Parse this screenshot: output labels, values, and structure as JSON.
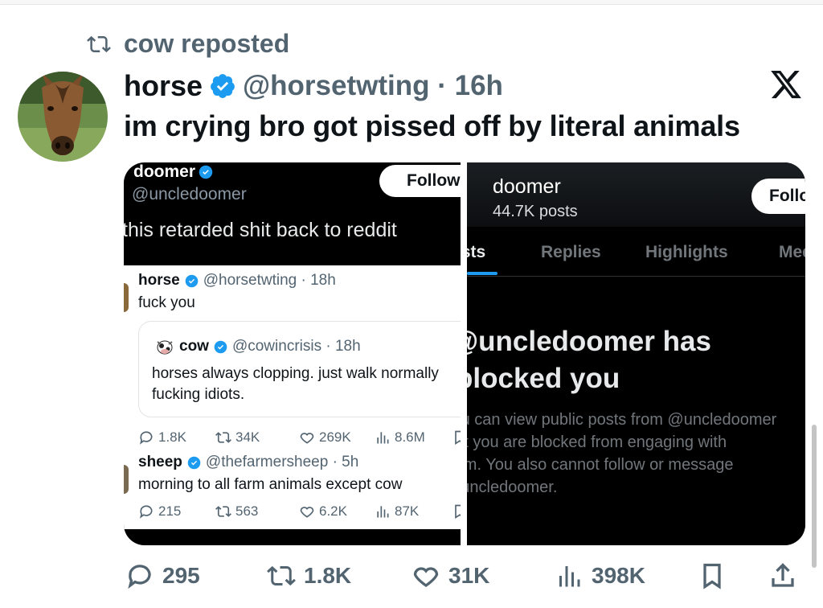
{
  "repost": {
    "label": "cow reposted"
  },
  "tweet": {
    "author_name": "horse",
    "handle_time": "@horsetwting · 16h",
    "text": "im crying bro got pissed off by literal animals"
  },
  "left_shot": {
    "top_name": "doomer",
    "top_handle": "@uncledoomer",
    "follow_label": "Follow",
    "top_text": "this retarded shit back to reddit",
    "reply1": {
      "name": "horse",
      "handle_time": "@horsetwting · 18h",
      "text": "fuck you"
    },
    "quote": {
      "name": "cow",
      "handle_time": "@cowincrisis · 18h",
      "line1": "horses always clopping. just walk normally",
      "line2": "fucking idiots."
    },
    "actions1": {
      "replies": "1.8K",
      "reposts": "34K",
      "likes": "269K",
      "views": "8.6M"
    },
    "reply2": {
      "name": "sheep",
      "handle_time": "@thefarmersheep · 5h",
      "text": "morning to all farm animals except cow"
    },
    "actions2": {
      "replies": "215",
      "reposts": "563",
      "likes": "6.2K",
      "views": "87K"
    }
  },
  "right_shot": {
    "name": "doomer",
    "posts": "44.7K posts",
    "follow_label": "Follow",
    "tabs": [
      "Posts",
      "Replies",
      "Highlights",
      "Media"
    ],
    "blocked_line1": "@uncledoomer has",
    "blocked_line2": "blocked you",
    "desc_line1": "You can view public posts from @uncledoomer",
    "desc_line2": "but you are blocked from engaging with",
    "desc_line3": "them. You also cannot follow or message",
    "desc_line4": "@uncledoomer."
  },
  "bottom_actions": {
    "replies": "295",
    "reposts": "1.8K",
    "likes": "31K",
    "views": "398K"
  },
  "colors": {
    "verified": "#1d9bf0",
    "muted": "#536471",
    "accent": "#1d9bf0"
  }
}
